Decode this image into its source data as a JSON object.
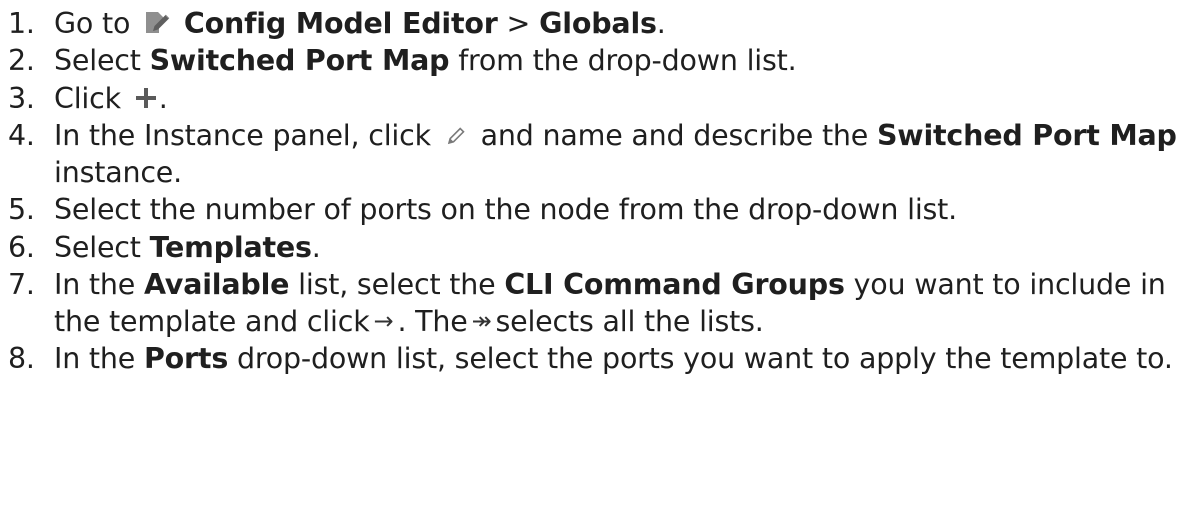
{
  "steps": [
    {
      "n": "1.",
      "parts": [
        "Go to",
        "Config Model Editor",
        " > ",
        "Globals",
        "."
      ]
    },
    {
      "n": "2.",
      "parts": [
        "Select ",
        "Switched Port Map",
        " from the drop-down list."
      ]
    },
    {
      "n": "3.",
      "parts": [
        "Click",
        "."
      ]
    },
    {
      "n": "4.",
      "parts": [
        "In the Instance panel, click",
        "and name and describe the ",
        "Switched Port Map",
        " instance."
      ]
    },
    {
      "n": "5.",
      "parts": [
        "Select the number of ports on the node from the drop-down list."
      ]
    },
    {
      "n": "6.",
      "parts": [
        "Select ",
        "Templates",
        "."
      ]
    },
    {
      "n": "7.",
      "parts": [
        "In the ",
        "Available",
        " list, select the ",
        "CLI Command Groups",
        " you want to include in the template and click",
        "→",
        ". The",
        "↠",
        "selects all the lists."
      ]
    },
    {
      "n": "8.",
      "parts": [
        "In the ",
        "Ports",
        " drop-down list, select the ports you want to apply the template to."
      ]
    }
  ],
  "icons": {
    "step1": "config-model-editor-icon",
    "step3": "plus-icon",
    "step4": "pencil-icon"
  },
  "colors": {
    "text": "#1f1f1f",
    "icon_gray": "#8a8a8a"
  }
}
